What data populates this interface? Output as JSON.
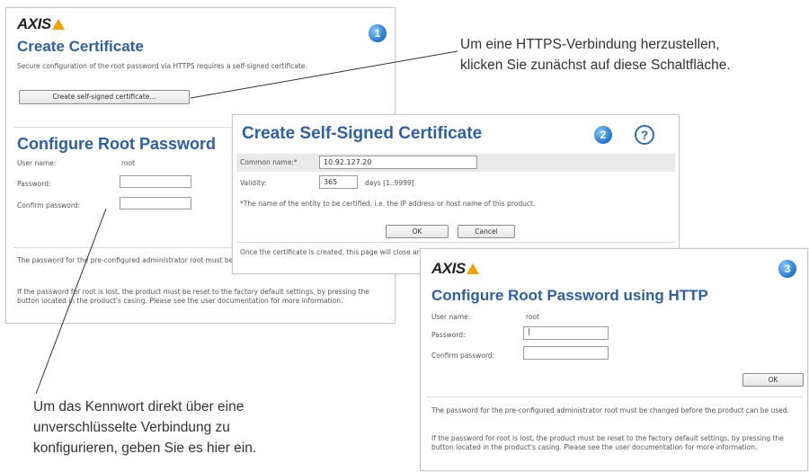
{
  "panel1": {
    "badge": "1",
    "title": "Create Certificate",
    "description": "Secure configuration of the root password via HTTPS requires a self-signed certificate.",
    "button_label": "Create self-signed certificate...",
    "section_title": "Configure Root Password",
    "username_label": "User name:",
    "username_value": "root",
    "password_label": "Password:",
    "confirm_label": "Confirm password:",
    "note1": "The password for the pre-configured administrator root must be changed before the product can be used.",
    "note2": "If the password for root is lost, the product must be reset to the factory default settings, by pressing the button located in the product's casing. Please see the user documentation for more information."
  },
  "panel2": {
    "badge": "2",
    "help": "?",
    "title": "Create Self-Signed Certificate",
    "common_name_label": "Common name:*",
    "common_name_value": "10.92.127.20",
    "validity_label": "Validity:",
    "validity_value": "365",
    "validity_unit": "days [1..9999]",
    "footnote": "*The name of the entity to be certified, i.e. the IP address or host name of this product.",
    "ok_label": "OK",
    "cancel_label": "Cancel",
    "info": "Once the certificate is created, this page will close and you will be able to configure the root password via HTTPS."
  },
  "panel3": {
    "badge": "3",
    "title": "Configure Root Password using HTTP",
    "username_label": "User name:",
    "username_value": "root",
    "password_label": "Password:",
    "confirm_label": "Confirm password:",
    "ok_label": "OK",
    "note1": "The password for the pre-configured administrator root must be changed before the product can be used.",
    "note2": "If the password for root is lost, the product must be reset to the factory default settings, by pressing the button located in the product's casing. Please see the user documentation for more information."
  },
  "brand": {
    "logo": "AXIS"
  },
  "colors": {
    "title_blue": "#2d5fa8",
    "badge_blue": "#2a7fd4",
    "logo_orange": "#f5a000"
  },
  "captions": {
    "top_right": [
      "Um eine HTTPS-Verbindung herzustellen,",
      "klicken Sie zunächst auf diese Schaltfläche."
    ],
    "bottom_left": [
      "Um das Kennwort direkt über eine",
      "unverschlüsselte Verbindung zu",
      "konfigurieren, geben Sie es hier ein."
    ]
  }
}
